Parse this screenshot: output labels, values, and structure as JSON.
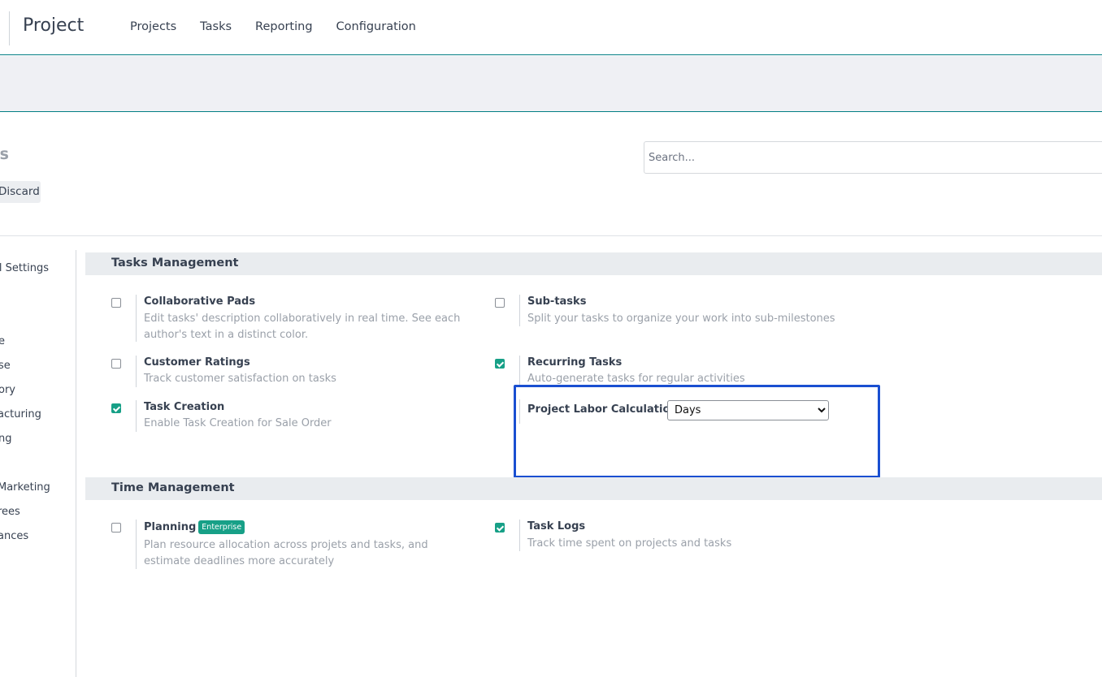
{
  "navbar": {
    "app_title": "Project",
    "menu": [
      "Projects",
      "Tasks",
      "Reporting",
      "Configuration"
    ]
  },
  "control_panel": {
    "title": "gs",
    "discard_label": "Discard",
    "search_placeholder": "Search..."
  },
  "sidebar": {
    "items": [
      "al Settings",
      "e",
      "se",
      "ory",
      "acturing",
      "ng",
      "Marketing",
      "rees",
      "ances"
    ]
  },
  "sections": {
    "tasks": {
      "title": "Tasks Management",
      "settings": [
        {
          "title": "Collaborative Pads",
          "desc": "Edit tasks' description collaboratively in real time. See each author's text in a distinct color.",
          "checked": false
        },
        {
          "title": "Sub-tasks",
          "desc": "Split your tasks to organize your work into sub-milestones",
          "checked": false
        },
        {
          "title": "Customer Ratings",
          "desc": "Track customer satisfaction on tasks",
          "checked": false
        },
        {
          "title": "Recurring Tasks",
          "desc": "Auto-generate tasks for regular activities",
          "checked": true
        },
        {
          "title": "Task Creation",
          "desc": "Enable Task Creation for Sale Order",
          "checked": true
        }
      ],
      "labor": {
        "label": "Project Labor Calculation",
        "value": "Days",
        "options": [
          "Days"
        ]
      }
    },
    "time": {
      "title": "Time Management",
      "settings": [
        {
          "title": "Planning",
          "badge": "Enterprise",
          "desc": "Plan resource allocation across projets and tasks, and estimate deadlines more accurately",
          "checked": false
        },
        {
          "title": "Task Logs",
          "desc": "Track time spent on projects and tasks",
          "checked": true
        }
      ]
    }
  },
  "colors": {
    "accent": "#17a087",
    "highlight": "#1a4fd1",
    "navbar_border": "#017e84"
  }
}
